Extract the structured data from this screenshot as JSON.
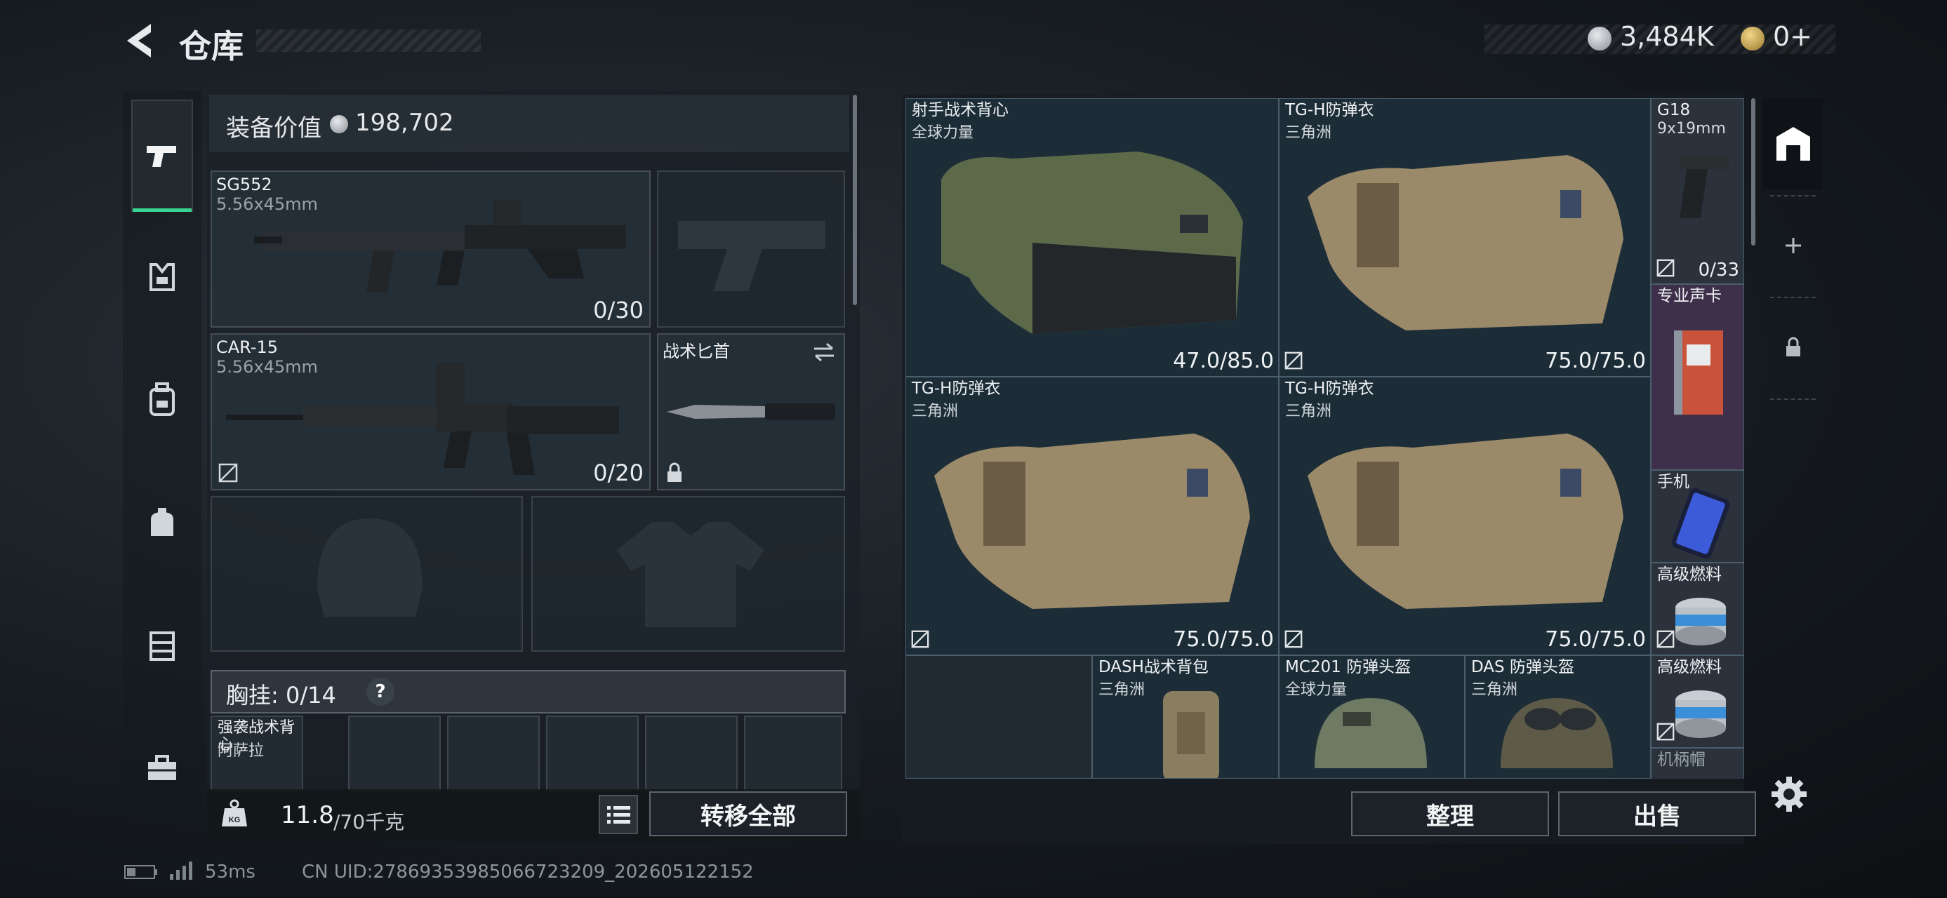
{
  "header": {
    "title": "仓库",
    "currency_1": "3,484K",
    "currency_2": "0+"
  },
  "categories": [
    "pistol-icon",
    "armor-icon",
    "backpack-icon",
    "bag-icon",
    "vest-icon",
    "toolbox-icon"
  ],
  "equipment": {
    "value_label": "装备价值",
    "value": "198,702",
    "primary": {
      "name": "SG552",
      "caliber": "5.56x45mm",
      "ammo": "0/30"
    },
    "secondary": {
      "name": "CAR-15",
      "caliber": "5.56x45mm",
      "ammo": "0/20"
    },
    "melee": {
      "name": "战术匕首"
    },
    "chest_rig_label": "胸挂: 0/14",
    "chest_rig_help": "?",
    "chest_item": {
      "name": "强袭战术背心",
      "sub": "阿萨拉"
    },
    "weight": "11.8",
    "weight_max": "/70千克",
    "weight_unit_icon": "KG",
    "transfer_all": "转移全部"
  },
  "stash": {
    "items": [
      {
        "name": "射手战术背心",
        "sub": "全球力量",
        "durability": "47.0/85.0"
      },
      {
        "name": "TG-H防弹衣",
        "sub": "三角洲",
        "durability": "75.0/75.0"
      },
      {
        "name": "G18",
        "sub": "9x19mm",
        "durability": "0/33"
      },
      {
        "name": "专业声卡",
        "sub": ""
      },
      {
        "name": "TG-H防弹衣",
        "sub": "三角洲",
        "durability": "75.0/75.0"
      },
      {
        "name": "TG-H防弹衣",
        "sub": "三角洲",
        "durability": "75.0/75.0"
      },
      {
        "name": "手机",
        "sub": ""
      },
      {
        "name": "高级燃料",
        "sub": ""
      },
      {
        "name": "DASH战术背包",
        "sub": "三角洲"
      },
      {
        "name": "MC201 防弹头盔",
        "sub": "全球力量"
      },
      {
        "name": "DAS 防弹头盔",
        "sub": "三角洲"
      },
      {
        "name": "高级燃料",
        "sub": ""
      },
      {
        "name": "机柄帽",
        "sub": ""
      }
    ],
    "sort_button": "整理",
    "sell_button": "出售"
  },
  "status": {
    "ping": "53ms",
    "uid": "CN UID:27869353985066723209_202605122152"
  },
  "colors": {
    "accent": "#37d48f",
    "stash_cell": "#1e2e3a",
    "panel": "#1a2026"
  }
}
